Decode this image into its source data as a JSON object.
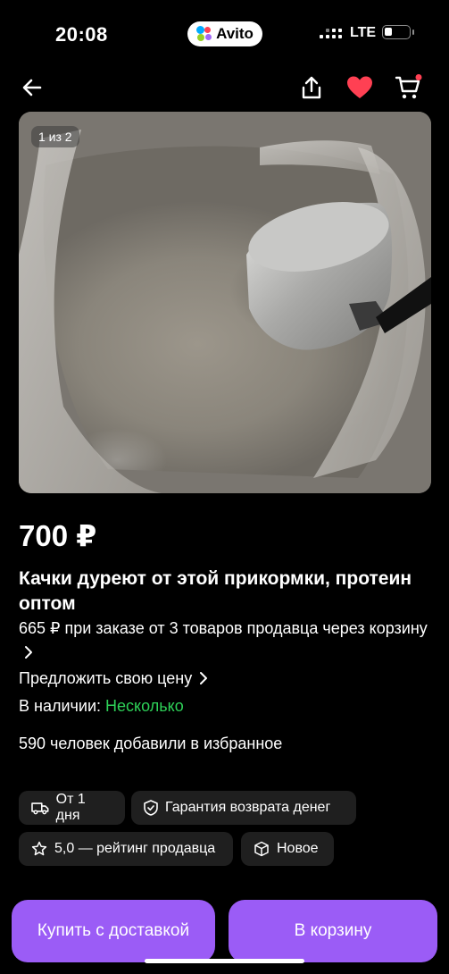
{
  "status_bar": {
    "time": "20:08",
    "app_pill": "Avito",
    "network": "LTE"
  },
  "listing": {
    "photo_counter": "1 из 2",
    "price": "700 ₽",
    "title": "Качки дуреют от этой прикормки, протеин оптом",
    "bulk_offer": "665 ₽ при заказе от 3 товаров продавца через корзину",
    "make_offer": "Предложить свою цену",
    "availability_label": "В наличии:",
    "availability_value": "Несколько",
    "favorites": "590 человек добавили в избранное",
    "favorited": true
  },
  "chips": {
    "delivery": "От 1 дня",
    "guarantee": "Гарантия возврата денег",
    "rating": "5,0 — рейтинг продавца",
    "condition": "Новое"
  },
  "actions": {
    "buy_delivery": "Купить с доставкой",
    "add_to_cart": "В корзину"
  },
  "colors": {
    "background": "#000000",
    "accent": "#9b5cf6",
    "in_stock": "#2ed158",
    "favorite": "#ff4053",
    "chip_bg": "#1f1f1f"
  },
  "icons": [
    "back-arrow-icon",
    "share-icon",
    "heart-icon",
    "cart-icon",
    "truck-icon",
    "shield-icon",
    "star-icon",
    "box-icon",
    "chevron-right-icon"
  ]
}
